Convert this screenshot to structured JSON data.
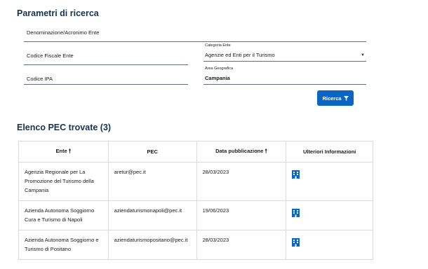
{
  "search": {
    "title": "Parametri di ricerca",
    "denominazione_placeholder": "Denominazione/Acronimo Ente",
    "codice_fiscale_placeholder": "Codice Fiscale Ente",
    "codice_ipa_placeholder": "Codice IPA",
    "categoria_label": "Categoria Ente",
    "categoria_value": "Agenzie ed Enti per il Turismo",
    "area_label": "Area Geografica",
    "area_value": "Campania",
    "button_label": "Ricerca"
  },
  "results": {
    "title": "Elenco PEC trovate (3)",
    "columns": [
      "Ente",
      "PEC",
      "Data pubblicazione",
      "Ulteriori Informazioni"
    ],
    "sort_arrow": "🠕",
    "rows": [
      {
        "ente": "Agenzia Regionale per La Promozione del Turismo della Campania",
        "pec": "aretur@pec.it",
        "data": "28/03/2023",
        "info_icon": "building-icon"
      },
      {
        "ente": "Azienda Autonoma Soggiorno Cura e Turismo di Napoli",
        "pec": "aziendaturismonapoli@pec.it",
        "data": "19/06/2023",
        "info_icon": "building-icon"
      },
      {
        "ente": "Azienda Autonoma Soggiorno e Turismo di Positano",
        "pec": "aziendaturismopositano@pec.it",
        "data": "28/03/2023",
        "info_icon": "building-icon"
      }
    ]
  },
  "colors": {
    "primary": "#0a66c2",
    "title": "#17324d",
    "border": "#d9dadb",
    "underline": "#5c6f82"
  }
}
